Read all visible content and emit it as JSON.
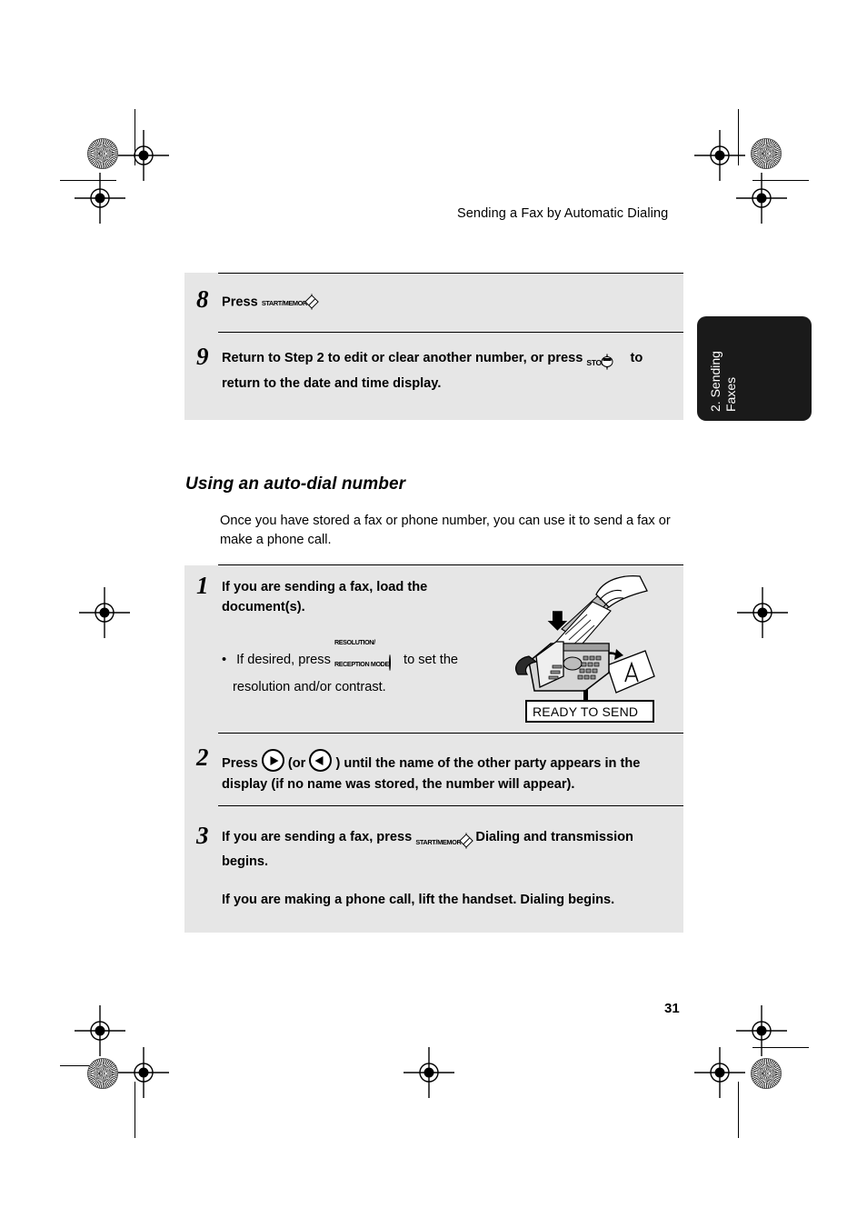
{
  "page": {
    "running_head": "Sending a Fax by Automatic Dialing",
    "folio": "31"
  },
  "thumb_tab": {
    "label": "2. Sending\nFaxes",
    "background": "#1a1a1a",
    "text_color": "#ffffff"
  },
  "keys": {
    "start_memory": {
      "cap": "START/MEMORY",
      "glyph": "diamond-play-icon"
    },
    "stop": {
      "cap": "STOP",
      "glyph": "stop-circle-icon"
    },
    "resolution": {
      "cap": "RESOLUTION/\nRECEPTION MODE",
      "glyph": "blank-oval-icon"
    },
    "arrow_right": {
      "glyph": "arrow-right-icon"
    },
    "arrow_left": {
      "glyph": "arrow-left-icon"
    }
  },
  "top_block": {
    "steps": [
      {
        "number": "8",
        "text_before": "Press",
        "key": "start_memory",
        "text_after": ""
      },
      {
        "number": "9",
        "text_before": "Return to Step 2 to edit or clear another number, or press",
        "key": "stop",
        "text_after": "to",
        "line2": "return to the date and time display."
      }
    ]
  },
  "section": {
    "heading": "Using an auto-dial number",
    "intro": "Once you have stored a fax or phone number, you can use it to send a fax or make a phone call."
  },
  "main_block": {
    "steps": [
      {
        "number": "1",
        "line1": "If you are sending a fax, load the",
        "line2": "document(s).",
        "bullet_before": "If desired, press",
        "bullet_key": "resolution",
        "bullet_after": "to set the",
        "bullet_line2": "resolution and/or contrast."
      },
      {
        "number": "2",
        "text_before": "Press",
        "mid_text": "(or",
        "text_after": ") until the name of the other party appears in the",
        "line2": "display (if no name was stored, the number will appear)."
      },
      {
        "number": "3",
        "line1_before": "If you are sending a fax, press",
        "line1_after": ". Dialing and transmission",
        "line2": "begins.",
        "line3": "If you are making a phone call, lift the handset. Dialing begins."
      }
    ]
  },
  "illustration": {
    "name": "fax-machine-loading-document",
    "lcd_text": "READY TO SEND",
    "arrow": "down-arrow-icon"
  },
  "colors": {
    "block_background": "#e6e6e6",
    "rule": "#000000",
    "page_background": "#ffffff"
  }
}
